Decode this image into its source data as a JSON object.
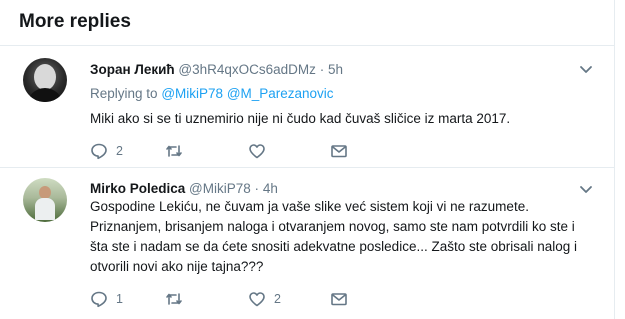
{
  "header": {
    "title": "More replies"
  },
  "tweets": [
    {
      "name": "Зоран Лекић",
      "handle": "@3hR4qxOCs6adDMz",
      "separator": "·",
      "time": "5h",
      "replying_prefix": "Replying to",
      "mentions": [
        "@MikiP78",
        "@M_Parezanovic"
      ],
      "text_lines": [
        "Miki ako si se ti uznemirio nije ni čudo kad čuvaš sličice iz marta 2017."
      ],
      "reply_count": "2",
      "retweet_count": "",
      "like_count": ""
    },
    {
      "name": "Mirko Poledica",
      "handle": "@MikiP78",
      "separator": "·",
      "time": "4h",
      "text_lines": [
        "Gospodine Lekiću, ne čuvam ja vaše slike već sistem koji vi ne razumete.",
        "Priznanjem, brisanjem naloga i otvaranjem novog, samo ste nam potvrdili ko ste i",
        "šta ste i nadam se da ćete snositi adekvatne posledice... Zašto ste obrisali nalog i",
        "otvorili novi ako nije tajna???"
      ],
      "reply_count": "1",
      "retweet_count": "",
      "like_count": "2"
    }
  ],
  "icons": {
    "reply": "reply-icon",
    "retweet": "retweet-icon",
    "like": "heart-icon",
    "dm": "envelope-icon",
    "caret": "chevron-down-icon"
  },
  "colors": {
    "link": "#1da1f2",
    "muted": "#657786",
    "text": "#14171a",
    "divider": "#e6ecf0"
  }
}
